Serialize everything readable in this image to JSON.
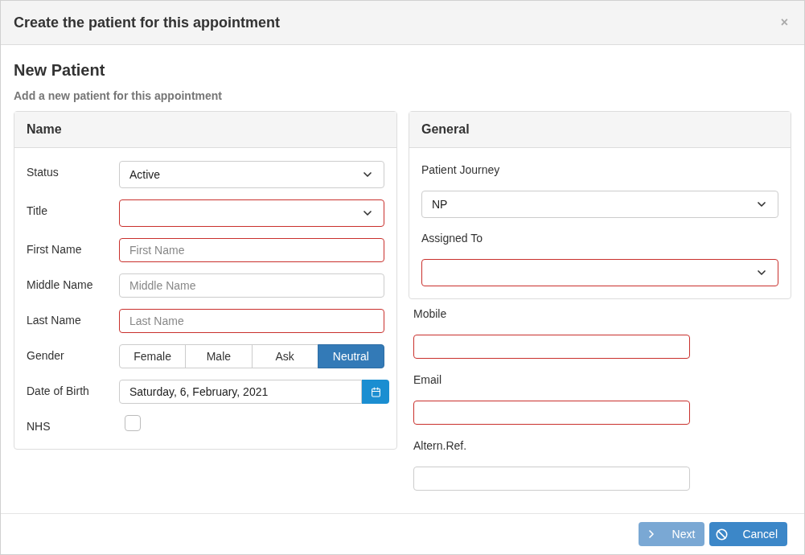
{
  "dialog": {
    "title": "Create the patient for this appointment",
    "close": "×"
  },
  "heading": "New Patient",
  "subheading": "Add a new patient for this appointment",
  "name_panel": {
    "title": "Name",
    "fields": [
      {
        "kind": "select",
        "label": "Status",
        "value": "Active",
        "invalid": false
      },
      {
        "kind": "select",
        "label": "Title",
        "invalid": true
      },
      {
        "kind": "text",
        "label": "First Name",
        "placeholder": "First Name",
        "invalid": true
      },
      {
        "kind": "text",
        "label": "Middle Name",
        "placeholder": "Middle Name",
        "invalid": false
      },
      {
        "kind": "text",
        "label": "Last Name",
        "placeholder": "Last Name",
        "invalid": true
      },
      {
        "kind": "toggle",
        "label": "Gender",
        "options": [
          {
            "label": "Female",
            "selected": false
          },
          {
            "label": "Male",
            "selected": false
          },
          {
            "label": "Ask",
            "selected": false
          },
          {
            "label": "Neutral",
            "selected": true
          }
        ]
      },
      {
        "kind": "date",
        "label": "Date of Birth",
        "value": "Saturday, 6, February, 2021"
      },
      {
        "kind": "checkbox",
        "label": "NHS",
        "checked": false
      }
    ]
  },
  "general_panel": {
    "title": "General",
    "fields": [
      {
        "label": "Patient Journey",
        "value": "NP",
        "invalid": false
      },
      {
        "label": "Assigned To",
        "invalid": true
      }
    ]
  },
  "contact_fields": [
    {
      "label": "Mobile",
      "invalid": true
    },
    {
      "label": "Email",
      "invalid": true
    },
    {
      "label": "Altern.Ref.",
      "invalid": false
    }
  ],
  "footer": {
    "buttons": [
      {
        "kind": "next",
        "label": "Next",
        "disabled": true
      },
      {
        "kind": "cancel",
        "label": "Cancel",
        "disabled": false
      }
    ]
  }
}
